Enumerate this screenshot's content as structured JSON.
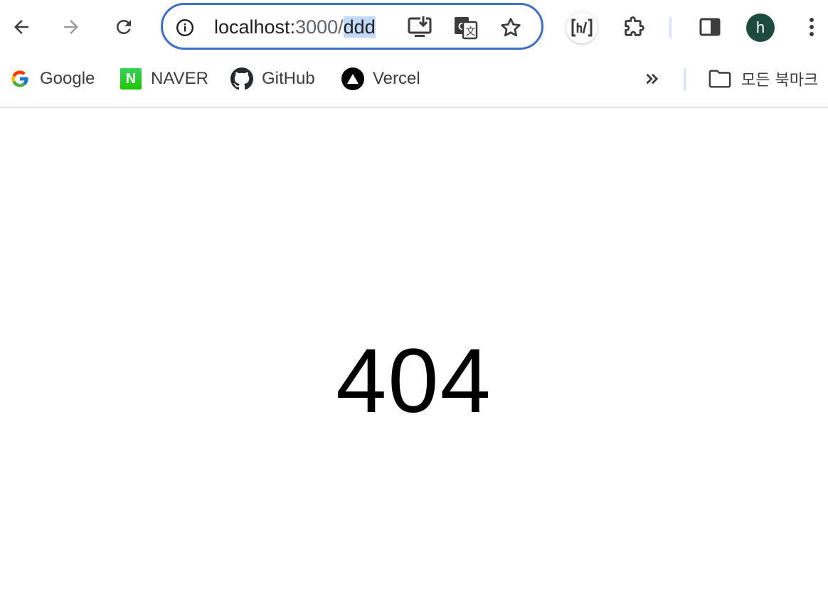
{
  "toolbar": {
    "back_icon": "arrow-left-icon",
    "forward_icon": "arrow-right-icon",
    "reload_icon": "reload-icon",
    "address": {
      "host": "localhost:",
      "port": "3000/",
      "path_selected": "ddd"
    },
    "profile_initial": "h",
    "colors": {
      "omnibox_border": "#3f6ec6",
      "selection": "#c2d8f7",
      "avatar_bg": "#1e4a3e"
    }
  },
  "bookmarks": {
    "items": [
      {
        "label": "Google",
        "icon": "google-icon"
      },
      {
        "label": "NAVER",
        "icon": "naver-icon"
      },
      {
        "label": "GitHub",
        "icon": "github-icon"
      },
      {
        "label": "Vercel",
        "icon": "vercel-icon"
      }
    ],
    "all_bookmarks_label": "모든 북마크",
    "naver_letter": "N"
  },
  "page": {
    "error_code": "404"
  }
}
